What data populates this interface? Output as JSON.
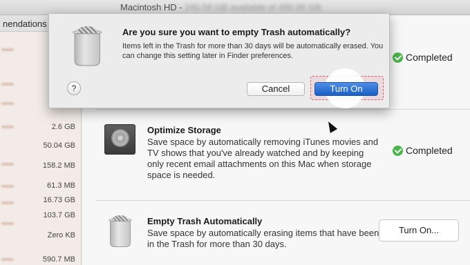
{
  "window": {
    "title": "Macintosh HD - ",
    "title_blurred": "246.58 GB available of 499.96 GB"
  },
  "sidebar": {
    "tab_label": "nendations",
    "sizes": [
      {
        "value": "30"
      },
      {
        "value": "255"
      },
      {
        "value": "2.6 GB"
      },
      {
        "value": "50.04 GB"
      },
      {
        "value": "158.2 MB"
      },
      {
        "value": "61.3 MB"
      },
      {
        "value": "16.73 GB"
      },
      {
        "value": "103.7 GB"
      },
      {
        "value": "Zero KB"
      },
      {
        "value": "590.7 MB"
      }
    ]
  },
  "sections": {
    "first": {
      "status": "Completed"
    },
    "optimize": {
      "title": "Optimize Storage",
      "description": "Save space by automatically removing iTunes movies and TV shows that you've already watched and by keeping only recent email attachments on this Mac when storage space is needed.",
      "status": "Completed"
    },
    "empty_trash": {
      "title": "Empty Trash Automatically",
      "description": "Save space by automatically erasing items that have been in the Trash for more than 30 days.",
      "button_label": "Turn On..."
    }
  },
  "dialog": {
    "title": "Are you sure you want to empty Trash automatically?",
    "message": "Items left in the Trash for more than 30 days will be automatically erased. You can change this setting later in Finder preferences.",
    "help_label": "?",
    "cancel_label": "Cancel",
    "confirm_label": "Turn On"
  },
  "colors": {
    "accent": "#1960c6",
    "success": "#4ab54a",
    "highlight": "#e05b6b"
  }
}
